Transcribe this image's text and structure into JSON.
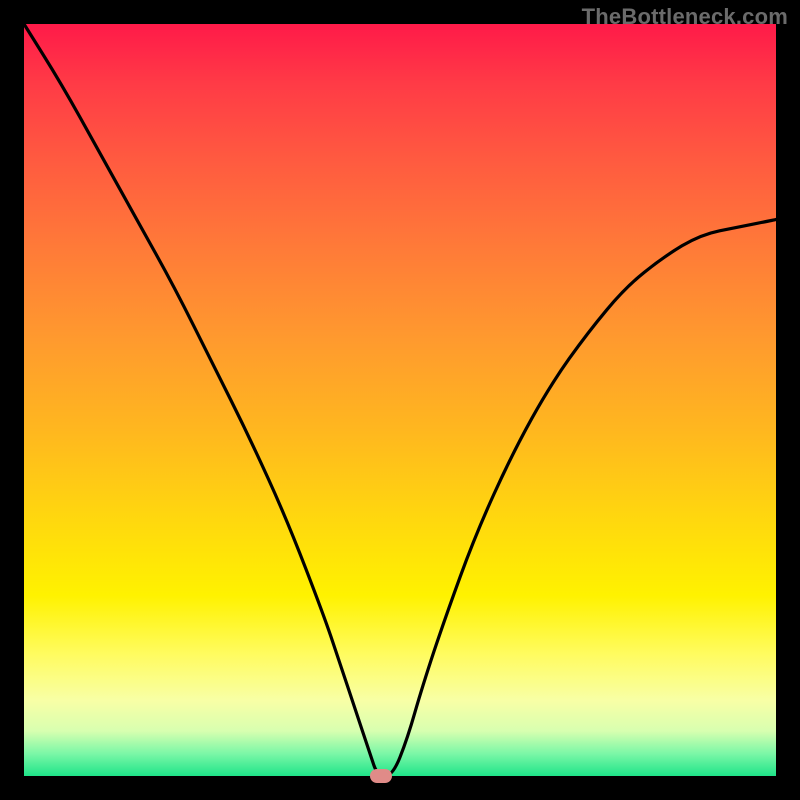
{
  "watermark": "TheBottleneck.com",
  "chart_data": {
    "type": "line",
    "title": "",
    "xlabel": "",
    "ylabel": "",
    "xlim": [
      0,
      1
    ],
    "ylim": [
      0,
      1
    ],
    "grid": false,
    "legend": false,
    "background_gradient": {
      "top": "#ff1a49",
      "bottom": "#1fe489",
      "direction": "vertical"
    },
    "series": [
      {
        "name": "curve",
        "color": "#000000",
        "x": [
          0.0,
          0.05,
          0.1,
          0.15,
          0.2,
          0.25,
          0.3,
          0.35,
          0.4,
          0.42,
          0.44,
          0.46,
          0.47,
          0.49,
          0.51,
          0.53,
          0.56,
          0.6,
          0.65,
          0.7,
          0.75,
          0.8,
          0.85,
          0.9,
          0.95,
          1.0
        ],
        "y": [
          1.0,
          0.92,
          0.83,
          0.74,
          0.65,
          0.55,
          0.45,
          0.34,
          0.21,
          0.15,
          0.09,
          0.03,
          0.0,
          0.0,
          0.05,
          0.12,
          0.21,
          0.32,
          0.43,
          0.52,
          0.59,
          0.65,
          0.69,
          0.72,
          0.73,
          0.74
        ]
      }
    ],
    "marker": {
      "x": 0.475,
      "y": 0.0,
      "color": "#e08b88",
      "shape": "rounded-rect"
    }
  }
}
